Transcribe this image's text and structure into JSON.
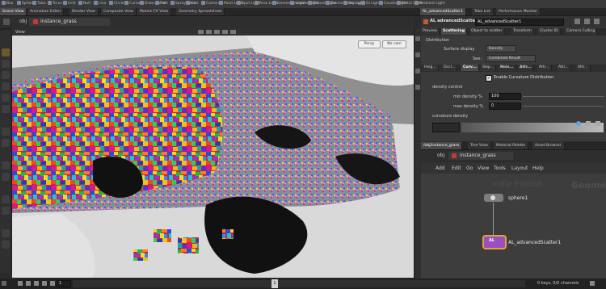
{
  "shelf": {
    "tools": [
      "Box",
      "Sphere",
      "Tube",
      "Torus",
      "Grid",
      "Null",
      "Line",
      "Circle",
      "Curve",
      "Draw Curve",
      "Path",
      "Spray Paint",
      "Font",
      "Camera",
      "Point Light",
      "Spot Light",
      "Area Light",
      "Geometry Light",
      "Volume Light",
      "Distant Light",
      "Environment Light",
      "Sky Light",
      "GI Light",
      "Caustic Light",
      "Portal Light",
      "Ambient Light"
    ],
    "tabs": [
      "Create",
      "Modify",
      "Model",
      "Polygon",
      "Deform",
      "Texture",
      "Rigging",
      "Characters",
      "Constraints",
      "Hair Utils",
      "Guide Process",
      "Terrain FX",
      "Simple FX",
      "Cloud FX",
      "Volume",
      "Lights and Cameras",
      "Collisions",
      "Particles",
      "Grains",
      "Rigid Bodies",
      "Particle Fluids",
      "Viscous Fluids",
      "Oceans",
      "Fluid Containers",
      "Populate Containers",
      "Container Tools",
      "Pyro FX",
      "FEM",
      "Wires",
      "Crowds",
      "Drive Simulation"
    ]
  },
  "left_tabs": [
    "Scene View",
    "Animation Editor",
    "Render View",
    "Composite View",
    "Motion FX View",
    "Geometry Spreadsheet"
  ],
  "right_tabs": [
    "AL_advancedScatter1",
    "Take List",
    "Performance Monitor"
  ],
  "viewport": {
    "path_obj": "obj",
    "path_node": "instance_grass",
    "title": "View",
    "persp": "Persp",
    "cam": "No cam"
  },
  "params": {
    "node_type": "AL advancedScatter",
    "node_name": "AL_advancedScatter1",
    "tabs": [
      "Preview",
      "Scattering",
      "Object to scatter",
      "Transform",
      "Cluster ID",
      "Camera Culling"
    ],
    "section": "Distribution",
    "surface_display_label": "Surface display",
    "surface_display_value": "Density",
    "see_label": "See:",
    "see_value": "Combined Result",
    "subtabs": [
      "Heig...",
      "Occl...",
      "Curv...",
      "Slop...",
      "Nois...",
      "Attr...",
      "Attr...",
      "Attr...",
      "Attr..."
    ],
    "enable_label": "Enable Curvature Distribution",
    "density_control_label": "density control",
    "min_density_label": "min density %",
    "min_density_value": "100",
    "max_density_label": "max density %",
    "max_density_value": "0",
    "curvature_density_label": "curvature density"
  },
  "network": {
    "tabs": [
      "/obj/instance_grass",
      "Tree View",
      "Material Palette",
      "Asset Browser"
    ],
    "path_obj": "obj",
    "path_node": "instance_grass",
    "menu": [
      "Add",
      "Edit",
      "Go",
      "View",
      "Tools",
      "Layout",
      "Help"
    ],
    "watermark_left": "Indie Edition",
    "watermark_right": "Geometry",
    "node1": "sphere1",
    "node2": "AL_advancedScatter1"
  },
  "timeline": {
    "frame": "1",
    "start": "1",
    "current_marker": "1",
    "status": "0 keys, 0/0 channels"
  },
  "colors": {
    "accent": "#d86a1e",
    "node_selected": "#e4a23b"
  }
}
